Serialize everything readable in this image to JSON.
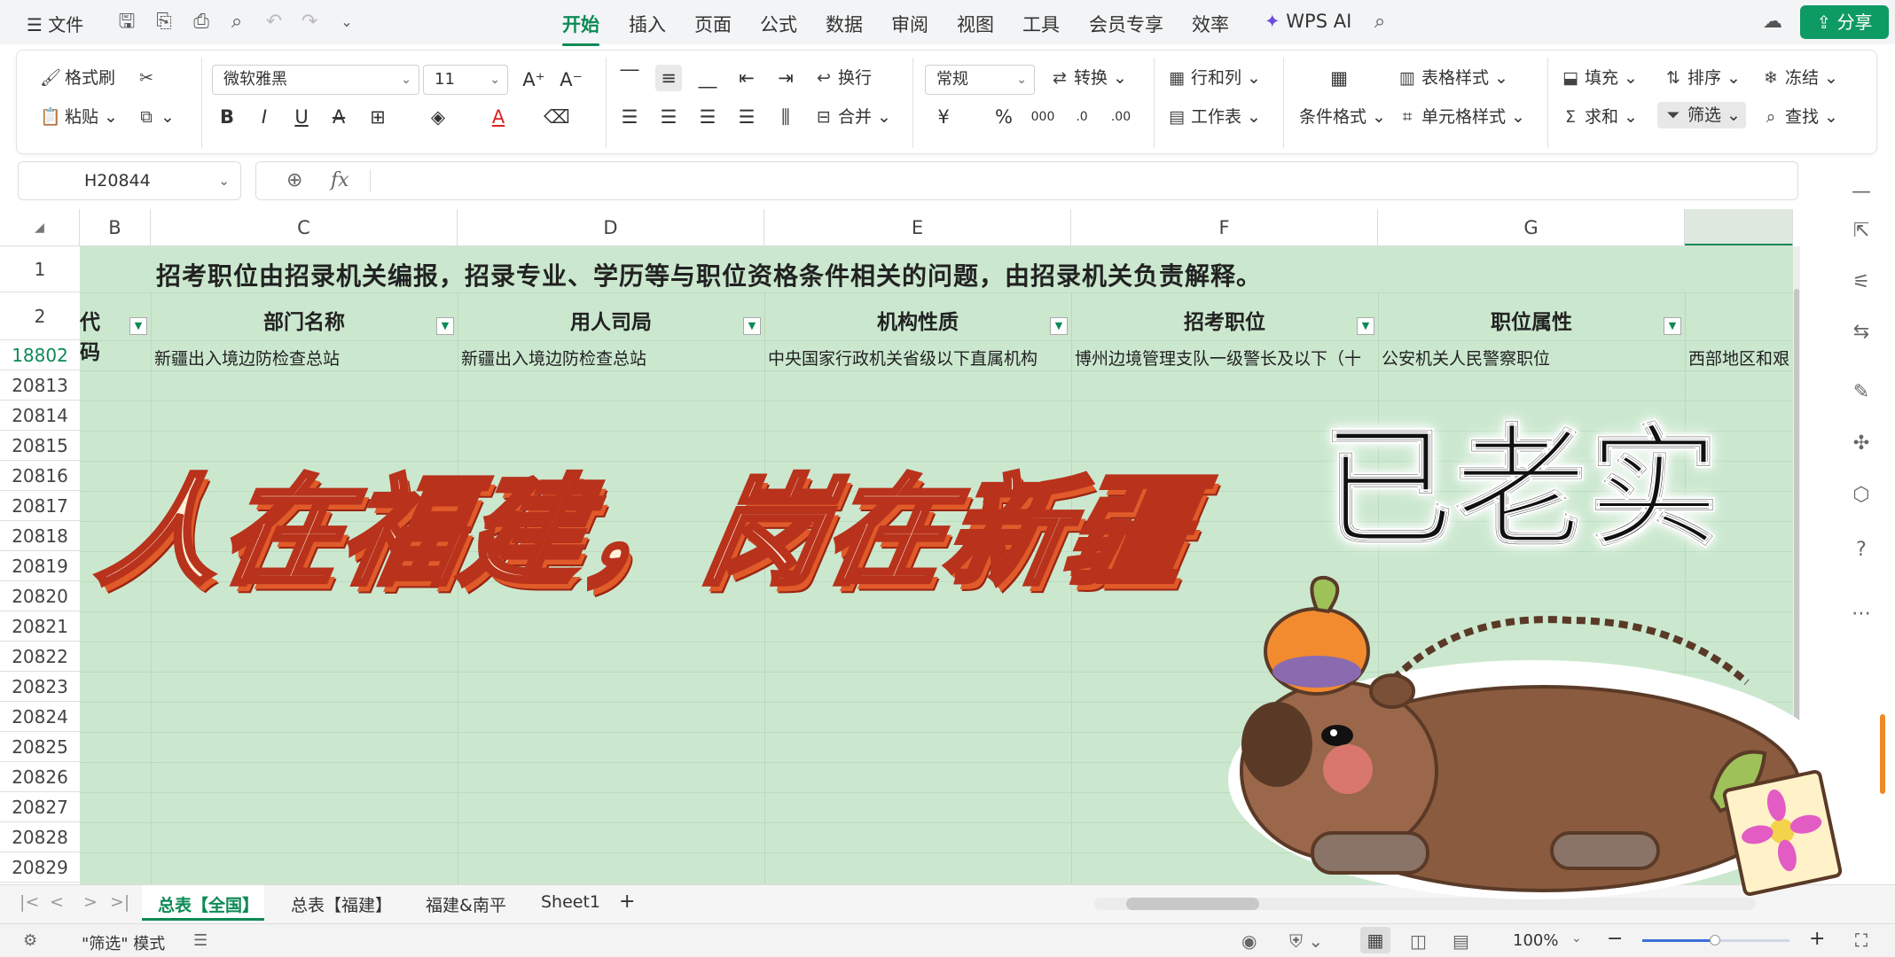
{
  "topbar": {
    "file_menu": "文件",
    "tabs": [
      "开始",
      "插入",
      "页面",
      "公式",
      "数据",
      "审阅",
      "视图",
      "工具",
      "会员专享",
      "效率"
    ],
    "active_tab": "开始",
    "wps_ai": "WPS AI",
    "share": "分享"
  },
  "ribbon": {
    "format_painter": "格式刷",
    "paste": "粘贴",
    "font_name": "微软雅黑",
    "font_size": "11",
    "wrap": "换行",
    "merge": "合并",
    "number_format": "常规",
    "convert": "转换",
    "rows_cols": "行和列",
    "worksheet": "工作表",
    "cond_format": "条件格式",
    "table_style": "表格样式",
    "cell_style": "单元格样式",
    "fill": "填充",
    "sort": "排序",
    "freeze": "冻结",
    "sum": "求和",
    "filter": "筛选",
    "find": "查找"
  },
  "formula_bar": {
    "cell_ref": "H20844",
    "fx": "fx",
    "content": ""
  },
  "grid": {
    "columns": [
      "B",
      "C",
      "D",
      "E",
      "F",
      "G"
    ],
    "row1_notice": "招考职位由招录机关编报，招录专业、学历等与职位资格条件相关的问题，由招录机关负责解释。",
    "headers": [
      "代码",
      "部门名称",
      "用人司局",
      "机构性质",
      "招考职位",
      "职位属性"
    ],
    "row_numbers": [
      "1",
      "2",
      "18802",
      "20813",
      "20814",
      "20815",
      "20816",
      "20817",
      "20818",
      "20819",
      "20820",
      "20821",
      "20822",
      "20823",
      "20824",
      "20825",
      "20826",
      "20827",
      "20828",
      "20829"
    ],
    "data_row": {
      "c": "新疆出入境边防检查总站",
      "d": "新疆出入境边防检查总站",
      "e": "中央国家行政机关省级以下直属机构",
      "f": "博州边境管理支队一级警长及以下（十",
      "g": "公安机关人民警察职位",
      "h": "西部地区和艰"
    }
  },
  "sheets": {
    "tabs": [
      "总表【全国】",
      "总表【福建】",
      "福建&南平",
      "Sheet1"
    ],
    "active": "总表【全国】"
  },
  "status": {
    "mode": "\"筛选\" 模式",
    "zoom": "100%"
  },
  "overlay": {
    "caption_left": "人在福建，岗在新疆",
    "caption_right": "已老实"
  },
  "colors": {
    "accent": "#0c8a55",
    "grid_fill": "#cbe8cf",
    "caption_stroke": "#b8321c"
  }
}
